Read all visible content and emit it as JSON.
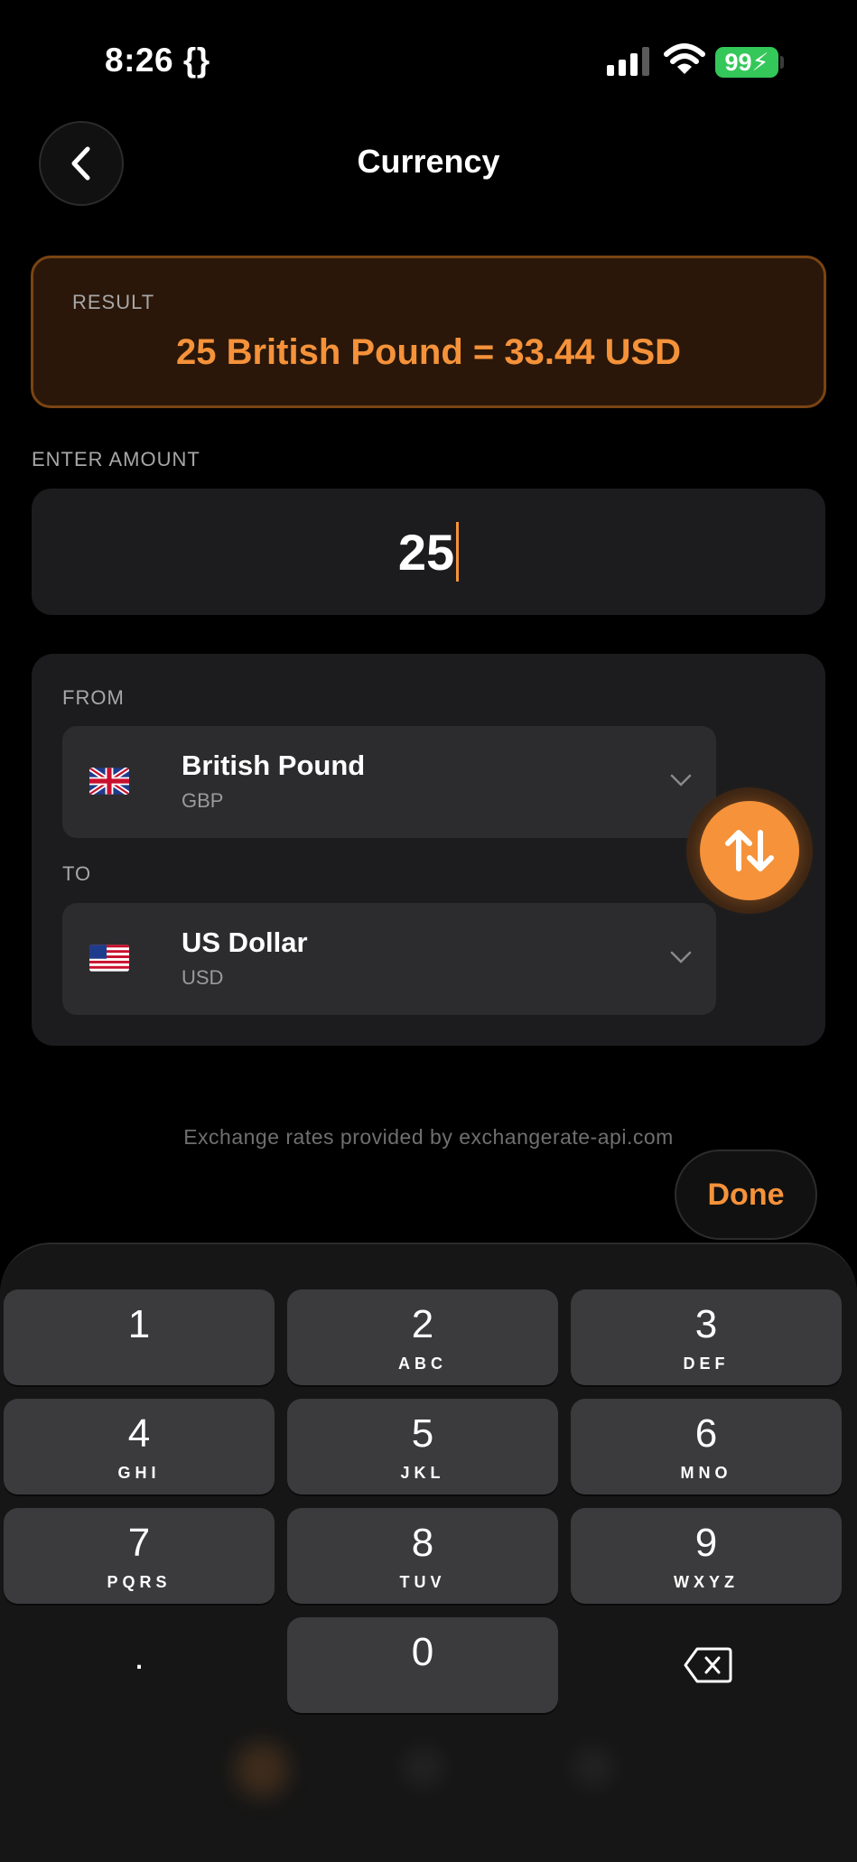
{
  "status_bar": {
    "time": "8:26 {}",
    "battery": "99"
  },
  "header": {
    "title": "Currency"
  },
  "result": {
    "label": "RESULT",
    "text": "25 British Pound = 33.44 USD"
  },
  "amount": {
    "label": "ENTER AMOUNT",
    "value": "25"
  },
  "from": {
    "label": "FROM",
    "name": "British Pound",
    "code": "GBP"
  },
  "to": {
    "label": "TO",
    "name": "US Dollar",
    "code": "USD"
  },
  "footnote": "Exchange rates provided by exchangerate-api.com",
  "done_label": "Done",
  "keypad": [
    {
      "num": "1",
      "letters": ""
    },
    {
      "num": "2",
      "letters": "ABC"
    },
    {
      "num": "3",
      "letters": "DEF"
    },
    {
      "num": "4",
      "letters": "GHI"
    },
    {
      "num": "5",
      "letters": "JKL"
    },
    {
      "num": "6",
      "letters": "MNO"
    },
    {
      "num": "7",
      "letters": "PQRS"
    },
    {
      "num": "8",
      "letters": "TUV"
    },
    {
      "num": "9",
      "letters": "WXYZ"
    },
    {
      "num": ".",
      "letters": ""
    },
    {
      "num": "0",
      "letters": ""
    }
  ],
  "colors": {
    "accent": "#f5923a",
    "background": "#000000",
    "card": "#1c1c1e"
  }
}
